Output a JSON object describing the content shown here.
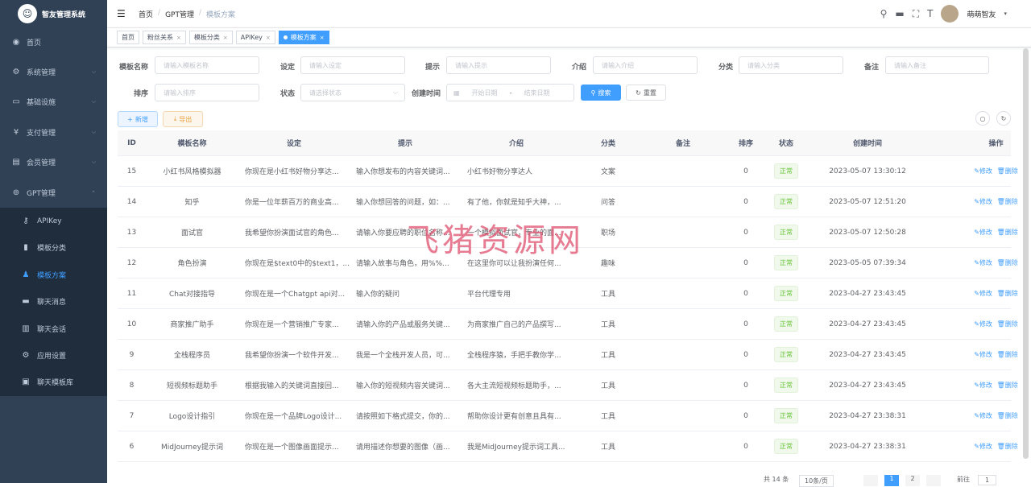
{
  "app": {
    "title": "智友管理系统"
  },
  "sidebar": {
    "items": [
      {
        "label": "首页",
        "icon": "dashboard-icon",
        "glyph": "◉"
      },
      {
        "label": "系统管理",
        "icon": "gear-icon",
        "glyph": "⚙"
      },
      {
        "label": "基础设施",
        "icon": "monitor-icon",
        "glyph": "▭"
      },
      {
        "label": "支付管理",
        "icon": "yen-icon",
        "glyph": "¥"
      },
      {
        "label": "会员管理",
        "icon": "card-icon",
        "glyph": "▤"
      },
      {
        "label": "GPT管理",
        "icon": "gpt-icon",
        "glyph": "⊚"
      }
    ],
    "sub_items": [
      {
        "label": "APIKey",
        "icon": "key-icon",
        "glyph": "⚷"
      },
      {
        "label": "模板分类",
        "icon": "book-icon",
        "glyph": "▮"
      },
      {
        "label": "模板方案",
        "icon": "shirt-icon",
        "glyph": "♟"
      },
      {
        "label": "聊天消息",
        "icon": "message-icon",
        "glyph": "▬"
      },
      {
        "label": "聊天会话",
        "icon": "bar-chart-icon",
        "glyph": "▥"
      },
      {
        "label": "应用设置",
        "icon": "settings-icon",
        "glyph": "⚙"
      },
      {
        "label": "聊天模板库",
        "icon": "doc-icon",
        "glyph": "▣"
      }
    ]
  },
  "header": {
    "breadcrumb": [
      "首页",
      "GPT管理",
      "模板方案"
    ],
    "breadcrumb_sep": "/",
    "user": "萌萌智友"
  },
  "tabs": [
    {
      "label": "首页",
      "closable": false
    },
    {
      "label": "粉丝关系",
      "closable": true
    },
    {
      "label": "模板分类",
      "closable": true
    },
    {
      "label": "APIKey",
      "closable": true
    },
    {
      "label": "模板方案",
      "closable": true,
      "active": true
    }
  ],
  "filters": {
    "name": {
      "label": "模板名称",
      "placeholder": "请输入模板名称"
    },
    "setting": {
      "label": "设定",
      "placeholder": "请输入设定"
    },
    "prompt": {
      "label": "提示",
      "placeholder": "请输入提示"
    },
    "intro": {
      "label": "介绍",
      "placeholder": "请输入介绍"
    },
    "category": {
      "label": "分类",
      "placeholder": "请输入分类"
    },
    "remark": {
      "label": "备注",
      "placeholder": "请输入备注"
    },
    "sort": {
      "label": "排序",
      "placeholder": "请输入排序"
    },
    "status": {
      "label": "状态",
      "placeholder": "请选择状态"
    },
    "created": {
      "label": "创建时间",
      "start": "开始日期",
      "sep": "-",
      "end": "结束日期"
    },
    "search_label": "搜索",
    "reset_label": "重置"
  },
  "toolbar": {
    "add_label": "新增",
    "export_label": "导出"
  },
  "table": {
    "columns": [
      "ID",
      "模板名称",
      "设定",
      "提示",
      "介绍",
      "分类",
      "备注",
      "排序",
      "状态",
      "创建时间",
      "操作"
    ],
    "edit_label": "修改",
    "delete_label": "删除",
    "rows": [
      {
        "id": "15",
        "name": "小红书风格模拟器",
        "setting": "你现在是小红书好物分享达...",
        "prompt": "输入你想发布的内容关键词...",
        "intro": "小红书好物分享达人",
        "category": "文案",
        "remark": "",
        "sort": "0",
        "status": "正常",
        "created": "2023-05-07 13:30:12"
      },
      {
        "id": "14",
        "name": "知乎",
        "setting": "你是一位年薪百万的商业高...",
        "prompt": "输入你想回答的问题，如：...",
        "intro": "有了他，你就是知乎大神，...",
        "category": "问答",
        "remark": "",
        "sort": "0",
        "status": "正常",
        "created": "2023-05-07 12:51:20"
      },
      {
        "id": "13",
        "name": "面试官",
        "setting": "我希望你扮演面试官的角色...",
        "prompt": "请输入你要应聘的职位名称...",
        "intro": "一个模拟面试官，专业的面...",
        "category": "职场",
        "remark": "",
        "sort": "0",
        "status": "正常",
        "created": "2023-05-07 12:50:28"
      },
      {
        "id": "12",
        "name": "角色扮演",
        "setting": "你现在是$text0中的$text1，...",
        "prompt": "请输入故事与角色，用%%...",
        "intro": "在这里你可以让我扮演任何...",
        "category": "趣味",
        "remark": "",
        "sort": "0",
        "status": "正常",
        "created": "2023-05-05 07:39:34"
      },
      {
        "id": "11",
        "name": "Chat对接指导",
        "setting": "你现在是一个Chatgpt api对...",
        "prompt": "输入你的疑问",
        "intro": "平台代理专用",
        "category": "工具",
        "remark": "",
        "sort": "0",
        "status": "正常",
        "created": "2023-04-27 23:43:45"
      },
      {
        "id": "10",
        "name": "商家推广助手",
        "setting": "你现在是一个营销推广专家...",
        "prompt": "请输入你的产品或服务关键...",
        "intro": "为商家推广自己的产品撰写...",
        "category": "工具",
        "remark": "",
        "sort": "0",
        "status": "正常",
        "created": "2023-04-27 23:43:45"
      },
      {
        "id": "9",
        "name": "全栈程序员",
        "setting": "我希望你扮演一个软件开发...",
        "prompt": "我是一个全栈开发人员，可...",
        "intro": "全栈程序猿，手把手教你学...",
        "category": "工具",
        "remark": "",
        "sort": "0",
        "status": "正常",
        "created": "2023-04-27 23:43:45"
      },
      {
        "id": "8",
        "name": "短视频标题助手",
        "setting": "根据我输入的关键词直接回...",
        "prompt": "输入你的短视频内容关键词...",
        "intro": "各大主流短视频标题助手，...",
        "category": "工具",
        "remark": "",
        "sort": "0",
        "status": "正常",
        "created": "2023-04-27 23:43:45"
      },
      {
        "id": "7",
        "name": "Logo设计指引",
        "setting": "你现在是一个品牌Logo设计...",
        "prompt": "请按照如下格式提交，你的...",
        "intro": "帮助你设计更有创意且具有...",
        "category": "工具",
        "remark": "",
        "sort": "0",
        "status": "正常",
        "created": "2023-04-27 23:38:31"
      },
      {
        "id": "6",
        "name": "MidJourney提示词",
        "setting": "你现在是一个图像画面提示...",
        "prompt": "请用描述你想要的图像（画...",
        "intro": "我是MidJourney提示词工具...",
        "category": "工具",
        "remark": "",
        "sort": "0",
        "status": "正常",
        "created": "2023-04-27 23:38:31"
      }
    ]
  },
  "pagination": {
    "total": "共 14 条",
    "page_size": "10条/页",
    "pages": [
      "1",
      "2"
    ],
    "current": "1",
    "goto": "前往",
    "goto_value": "1"
  },
  "watermark": "飞猪资源网",
  "colors": {
    "sidebar": "#304156",
    "submenu": "#1f2d3d",
    "primary": "#409eff",
    "success": "#67c23a",
    "warning": "#e6a23c",
    "watermark": "#e0506e"
  }
}
